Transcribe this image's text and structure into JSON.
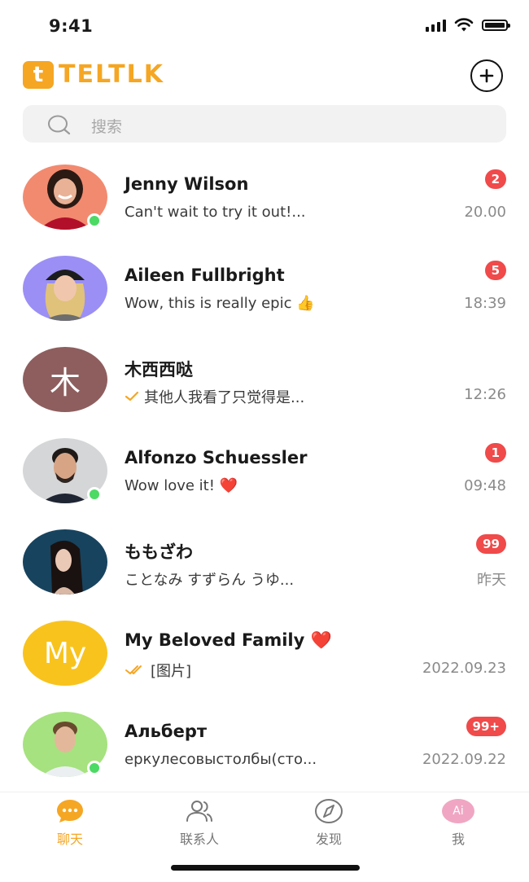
{
  "status_bar": {
    "time": "9:41"
  },
  "header": {
    "logo_mark": "t",
    "logo_text": "TELTLK",
    "add_icon": "plus-circle-icon"
  },
  "search": {
    "placeholder": "搜索",
    "icon": "search-icon"
  },
  "colors": {
    "accent": "#f5a623",
    "badge": "#f04a4a",
    "online": "#4cd964"
  },
  "chats": [
    {
      "name": "Jenny Wilson",
      "preview": "Can't wait to try it out!...",
      "time": "20.00",
      "badge": "2",
      "online": true,
      "avatar": "photo-woman-smiling"
    },
    {
      "name": "Aileen Fullbright",
      "preview": "Wow, this is really epic 👍",
      "time": "18:39",
      "badge": "5",
      "online": false,
      "avatar": "photo-woman-beanie"
    },
    {
      "name": "木西西哒",
      "preview": "其他人我看了只觉得是...",
      "time": "12:26",
      "badge": "",
      "online": false,
      "avatar_letter": "木",
      "avatar_color": "#8e5e5e",
      "status_icon": "single-check-icon"
    },
    {
      "name": "Alfonzo Schuessler",
      "preview": "Wow love it! ❤️",
      "time": "09:48",
      "badge": "1",
      "online": true,
      "avatar": "photo-man-beard"
    },
    {
      "name": "ももざわ",
      "preview": "ことなみ すずらん うゆ...",
      "time": "昨天",
      "badge": "99",
      "online": false,
      "avatar": "photo-woman-profile"
    },
    {
      "name": "My Beloved Family ❤️",
      "preview": "[图片]",
      "time": "2022.09.23",
      "badge": "",
      "online": false,
      "avatar_letter": "My",
      "avatar_color": "#f9c31d",
      "status_icon": "double-check-icon"
    },
    {
      "name": "Альберт",
      "preview": "еркулесовыстолбы(сто...",
      "time": "2022.09.22",
      "badge": "99+",
      "online": true,
      "avatar": "photo-man-green"
    }
  ],
  "tabs": [
    {
      "label": "聊天",
      "icon": "chat-bubble-icon",
      "active": true
    },
    {
      "label": "联系人",
      "icon": "contacts-icon",
      "active": false
    },
    {
      "label": "发现",
      "icon": "compass-icon",
      "active": false
    },
    {
      "label": "我",
      "icon": "profile-avatar-icon",
      "avatar_text": "Ai",
      "active": false
    }
  ]
}
